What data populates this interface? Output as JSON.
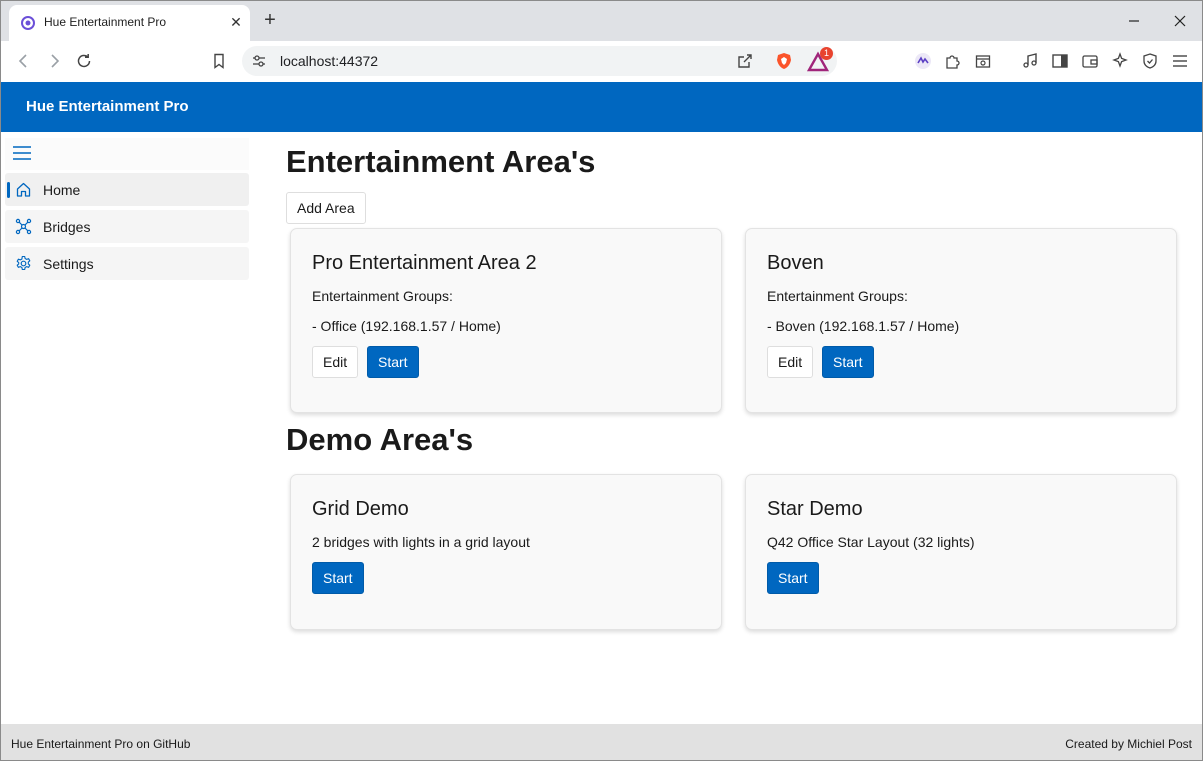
{
  "browser": {
    "tab_title": "Hue Entertainment Pro",
    "url": "localhost:44372",
    "rewards_badge": "1"
  },
  "app": {
    "title": "Hue Entertainment Pro",
    "accent_color": "#0067c0"
  },
  "sidebar": {
    "items": [
      {
        "label": "Home",
        "icon": "home-icon",
        "active": true
      },
      {
        "label": "Bridges",
        "icon": "bridges-network-icon",
        "active": false
      },
      {
        "label": "Settings",
        "icon": "gear-icon",
        "active": false
      }
    ]
  },
  "main": {
    "entertainment_heading": "Entertainment Area's",
    "add_area_label": "Add Area",
    "entertainment_areas": [
      {
        "title": "Pro Entertainment Area 2",
        "groups_label": "Entertainment Groups:",
        "group": "- Office (192.168.1.57 / Home)",
        "edit_label": "Edit",
        "start_label": "Start"
      },
      {
        "title": "Boven",
        "groups_label": "Entertainment Groups:",
        "group": "- Boven (192.168.1.57 / Home)",
        "edit_label": "Edit",
        "start_label": "Start"
      }
    ],
    "demo_heading": "Demo Area's",
    "demo_areas": [
      {
        "title": "Grid Demo",
        "description": "2 bridges with lights in a grid layout",
        "start_label": "Start"
      },
      {
        "title": "Star Demo",
        "description": "Q42 Office Star Layout (32 lights)",
        "start_label": "Start"
      }
    ]
  },
  "footer": {
    "left": "Hue Entertainment Pro on GitHub",
    "right": "Created by Michiel Post"
  }
}
